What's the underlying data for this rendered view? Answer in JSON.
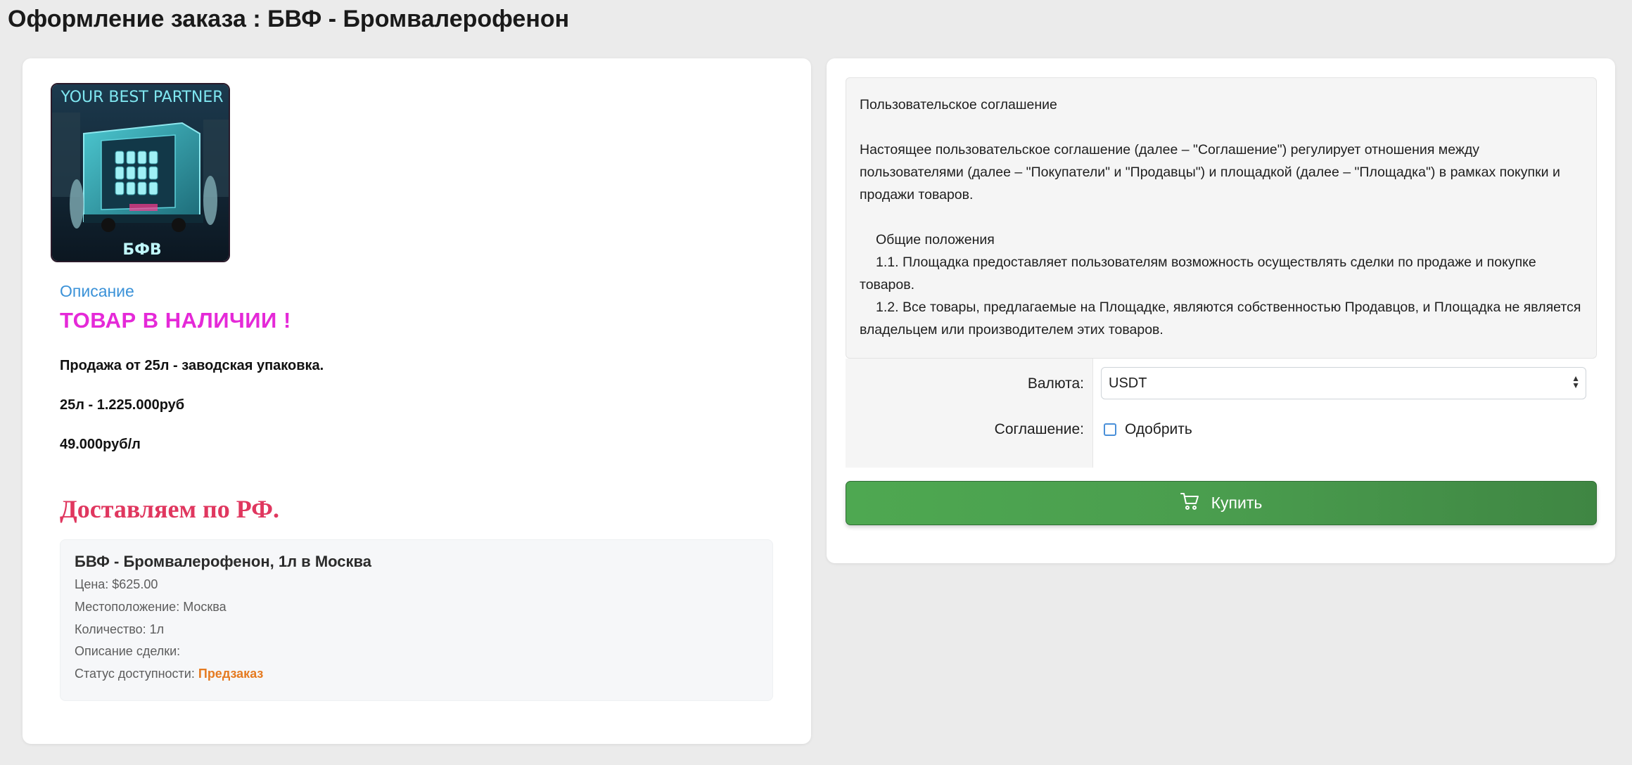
{
  "page": {
    "title": "Оформление заказа : БВФ - Бромвалерофенон"
  },
  "product": {
    "image_alt": "БФВ",
    "image_texts": {
      "banner": "YOUR BEST PARTNER",
      "caption": "БФВ"
    },
    "description_link": "Описание",
    "in_stock_text": "ТОВАР В НАЛИЧИИ !",
    "description_lines": [
      "Продажа от 25л - заводская упаковка.",
      "25л - 1.225.000руб",
      "49.000руб/л"
    ],
    "delivery_text": "Доставляем по РФ."
  },
  "deal": {
    "title": "БВФ - Бромвалерофенон, 1л в Москва",
    "price_label": "Цена: $625.00",
    "location_label": "Местоположение: Москва",
    "quantity_label": "Количество: 1л",
    "description_label": "Описание сделки:",
    "status_label": "Статус доступности: ",
    "status_value": "Предзаказ"
  },
  "agreement": {
    "title": "Пользовательское соглашение",
    "intro": "Настоящее пользовательское соглашение (далее – \"Соглашение\") регулирует отношения между пользователями (далее – \"Покупатели\" и \"Продавцы\") и площадкой (далее – \"Площадка\") в рамках покупки и продажи товаров.",
    "section_title": "Общие положения",
    "item_1": "1.1. Площадка предоставляет пользователям возможность осуществлять сделки по продаже и покупке товаров.",
    "item_2": "1.2. Все товары, предлагаемые на Площадке, являются собственностью Продавцов, и Площадка не является владельцем или производителем этих товаров."
  },
  "form": {
    "currency_label": "Валюта:",
    "currency_value": "USDT",
    "agreement_label": "Соглашение:",
    "approve_label": "Одобрить",
    "approve_checked": false
  },
  "buy_button": {
    "label": "Купить",
    "icon": "shopping-cart-icon"
  },
  "colors": {
    "in_stock": "#e529d8",
    "delivery": "#e0375f",
    "link": "#3b92d8",
    "status_preorder": "#e57b22",
    "buy_button": "#4a9d4e"
  }
}
